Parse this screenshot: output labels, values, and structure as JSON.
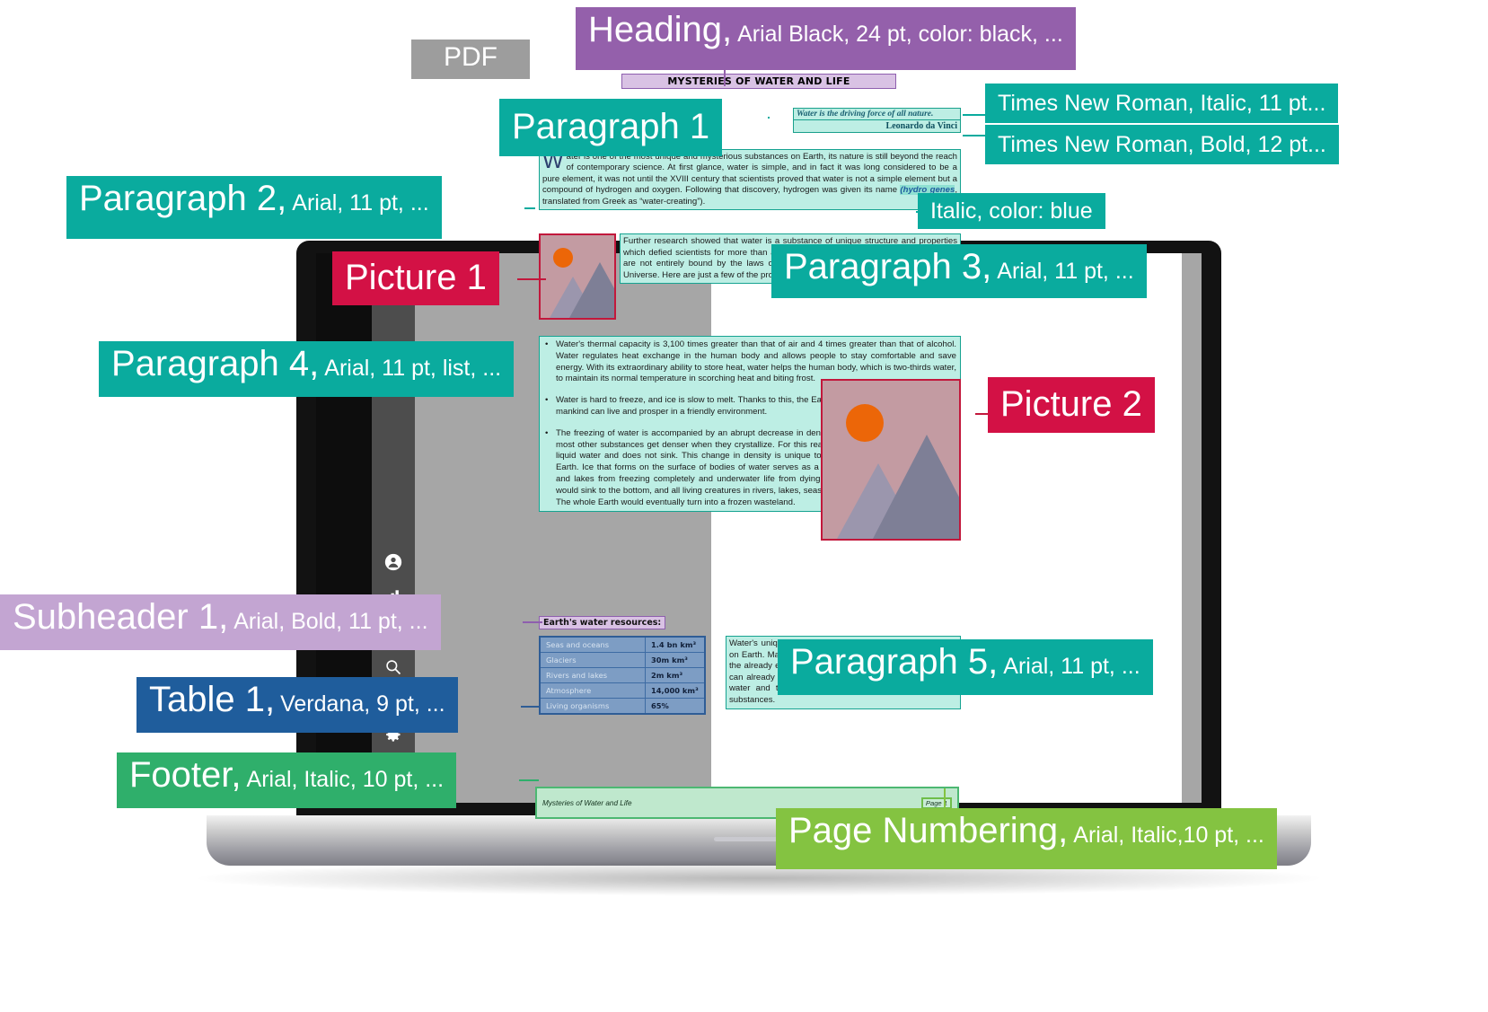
{
  "badge": {
    "pdf": "PDF"
  },
  "document": {
    "title": "MYSTERIES OF WATER AND LIFE",
    "quote": {
      "text": "Water is the driving force of all nature.",
      "author": "Leonardo da Vinci"
    },
    "paragraph1": {
      "dropcap": "W",
      "text_a": "ater is one of the most unique and mysterious substances on Earth, its nature is still beyond the reach of contemporary science. At first glance, water is simple, and in fact it was long considered to be a pure element, it was not until the XVIII century that scientists proved that water is not a simple element but a compound of hydrogen and oxygen. Following that discovery, hydrogen was given its name ",
      "italic_blue": "(hydro genes",
      "text_b": ", translated from Greek as “water-creating”)."
    },
    "paragraph3": "Further research showed that water is a substance of unique structure and properties which defied scientists for more than a century. We are aware that water's properties are not entirely bound by the laws of physics which govern all other things in the Universe. Here are just a few of the properties of this life-giving substance:",
    "paragraph4": {
      "items": [
        "Water's thermal capacity is 3,100 times greater than that of air and 4 times greater than that of alcohol. Water regulates heat exchange in the human body and allows people to stay comfortable and save energy. With its extraordinary ability to store heat, water helps the human body, which is two-thirds water, to maintain its normal temperature in scorching heat and biting frost.",
        "Water is hard to freeze, and ice is slow to melt. Thanks to this, the Earth’s climate is stable and mild, and mankind can live and prosper in a friendly environment.",
        "The freezing of water is accompanied by an abrupt decrease in density by more than 8 per cent, while most other substances get denser when they crystallize. For this reason ice occupies more space than liquid water and does not sink. This change in density is unique to water and is crucial for all life on Earth. Ice that forms on the surface of bodies of water serves as a floating blanket which saves rivers and lakes from freezing completely and underwater life from dying. If ice were heavier than water, it would sink to the bottom, and all living creatures in rivers, lakes, seas, and oceans would freeze and die. The whole Earth would eventually turn into a frozen wasteland."
      ]
    },
    "subheader": "Earth's water resources:",
    "table": {
      "rows": [
        {
          "label": "Seas and oceans",
          "value": "1.4 bn km³"
        },
        {
          "label": "Glaciers",
          "value": "30m km³"
        },
        {
          "label": "Rivers and lakes",
          "value": "2m km³"
        },
        {
          "label": "Atmosphere",
          "value": "14,000 km³"
        },
        {
          "label": "Living organisms",
          "value": "65%"
        }
      ]
    },
    "paragraph5": "Water's unique properties make it the foundation of all life on Earth. Many of them are still a mystery to scientists, but the already established facts about water and its behaviour can already help us to better understand the properties of water and the peculiarities of its interaction with other substances.",
    "footer": {
      "text": "Mysteries of Water and Life",
      "page_number": "Page 1"
    }
  },
  "callouts": [
    {
      "id": "heading",
      "big": "Heading,",
      "small": "Arial Black, 24 pt, color: black, ...",
      "color": "#9460ab"
    },
    {
      "id": "times-italic",
      "big": "",
      "small": "Times New Roman, Italic, 11 pt...",
      "color": "#0aab9e"
    },
    {
      "id": "times-bold",
      "big": "",
      "small": "Times New Roman, Bold, 12 pt...",
      "color": "#0aab9e"
    },
    {
      "id": "paragraph-1",
      "big": "Paragraph 1",
      "small": "",
      "color": "#0aab9e"
    },
    {
      "id": "paragraph-2",
      "big": "Paragraph 2,",
      "small": "Arial, 11 pt, ...",
      "color": "#0aab9e"
    },
    {
      "id": "italic-blue",
      "big": "",
      "small": "Italic, color: blue",
      "color": "#0aab9e"
    },
    {
      "id": "picture-1",
      "big": "Picture 1",
      "small": "",
      "color": "#d31145"
    },
    {
      "id": "paragraph-3",
      "big": "Paragraph 3,",
      "small": "Arial, 11 pt, ...",
      "color": "#0aab9e"
    },
    {
      "id": "paragraph-4",
      "big": "Paragraph 4,",
      "small": "Arial, 11 pt, list, ...",
      "color": "#0aab9e"
    },
    {
      "id": "picture-2",
      "big": "Picture 2",
      "small": "",
      "color": "#d31145"
    },
    {
      "id": "subheader-1",
      "big": "Subheader 1,",
      "small": "Arial, Bold, 11 pt, ...",
      "color": "#c3a5d2"
    },
    {
      "id": "paragraph-5",
      "big": "Paragraph 5,",
      "small": "Arial, 11 pt, ...",
      "color": "#0aab9e"
    },
    {
      "id": "table-1",
      "big": "Table 1,",
      "small": "Verdana, 9 pt, ...",
      "color": "#1f5d9c"
    },
    {
      "id": "footer",
      "big": "Footer,",
      "small": "Arial, Italic, 10 pt, ...",
      "color": "#2faf6b"
    },
    {
      "id": "page-number",
      "big": "Page Numbering,",
      "small": "Arial, Italic,10 pt, ...",
      "color": "#84c341"
    }
  ],
  "app_rail": {
    "icons": [
      "user-icon",
      "bar-chart-icon",
      "search-icon",
      "mail-icon",
      "gear-icon",
      "bell-icon"
    ]
  }
}
